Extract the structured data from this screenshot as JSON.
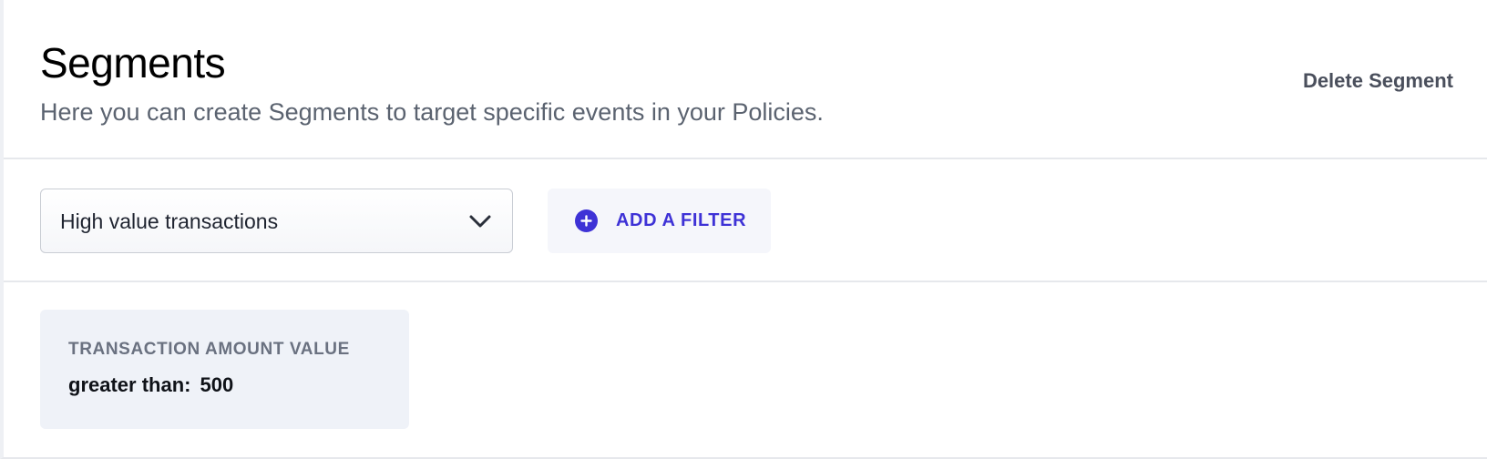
{
  "header": {
    "title": "Segments",
    "subtitle": "Here you can create Segments to target specific events in your Policies.",
    "delete_label": "Delete Segment"
  },
  "toolbar": {
    "segment_select": {
      "selected_value": "High value transactions",
      "icon": "chevron-down-icon"
    },
    "add_filter": {
      "label": "ADD A FILTER",
      "icon": "plus-circle-icon"
    }
  },
  "filters": [
    {
      "field": "TRANSACTION AMOUNT VALUE",
      "operator": "greater than:",
      "value": "500"
    }
  ],
  "colors": {
    "accent": "#3e32d6",
    "card_background": "#eff2f8",
    "button_background": "#f5f6fb",
    "subtitle_text": "#5b6370",
    "divider": "#e6e8ec"
  }
}
